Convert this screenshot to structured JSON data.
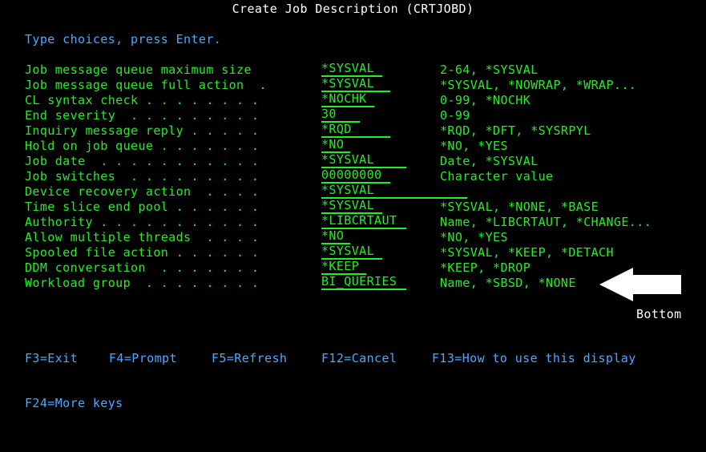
{
  "screen": {
    "title": "Create Job Description (CRTJOBD)",
    "instruction": "Type choices, press Enter."
  },
  "fields": [
    {
      "label": "Job message queue maximum size",
      "value": "*SYSVAL",
      "choices": "2-64, *SYSVAL"
    },
    {
      "label": "Job message queue full action  .",
      "value": "*SYSVAL",
      "choices": "*SYSVAL, *NOWRAP, *WRAP..."
    },
    {
      "label": "CL syntax check . . . . . . . .",
      "value": "*NOCHK",
      "choices": "0-99, *NOCHK"
    },
    {
      "label": "End severity  . . . . . . . . .",
      "value": "30",
      "choices": "0-99"
    },
    {
      "label": "Inquiry message reply . . . . .",
      "value": "*RQD",
      "choices": "*RQD, *DFT, *SYSRPYL"
    },
    {
      "label": "Hold on job queue . . . . . . .",
      "value": "*NO",
      "choices": "*NO, *YES"
    },
    {
      "label": "Job date  . . . . . . . . . . .",
      "value": "*SYSVAL",
      "choices": "Date, *SYSVAL"
    },
    {
      "label": "Job switches  . . . . . . . . .",
      "value": "00000000",
      "choices": "Character value"
    },
    {
      "label": "Device recovery action  . . . .",
      "value": "*SYSVAL",
      "choices": ""
    },
    {
      "label": "Time slice end pool . . . . . .",
      "value": "*SYSVAL",
      "choices": "*SYSVAL, *NONE, *BASE"
    },
    {
      "label": "Authority . . . . . . . . . . .",
      "value": "*LIBCRTAUT",
      "choices": "Name, *LIBCRTAUT, *CHANGE..."
    },
    {
      "label": "Allow multiple threads  . . . .",
      "value": "*NO",
      "choices": "*NO, *YES"
    },
    {
      "label": "Spooled file action . . . . . .",
      "value": "*SYSVAL",
      "choices": "*SYSVAL, *KEEP, *DETACH"
    },
    {
      "label": "DDM conversation  . . . . . . .",
      "value": "*KEEP",
      "choices": "*KEEP, *DROP"
    },
    {
      "label": "Workload group  . . . . . . . .",
      "value": "BI_QUERIES",
      "choices": "Name, *SBSD, *NONE"
    }
  ],
  "more_indicator": "Bottom",
  "annotation_icon": "arrow-left-icon",
  "function_keys": {
    "f3": "F3=Exit",
    "f4": "F4=Prompt",
    "f5": "F5=Refresh",
    "f12": "F12=Cancel",
    "f13": "F13=How to use this display",
    "f24": "F24=More keys"
  },
  "colors": {
    "background": "#000000",
    "field_text": "#22ee22",
    "title_text": "#ffffff",
    "info_text": "#4aa8ff",
    "arrow": "#ffffff"
  }
}
